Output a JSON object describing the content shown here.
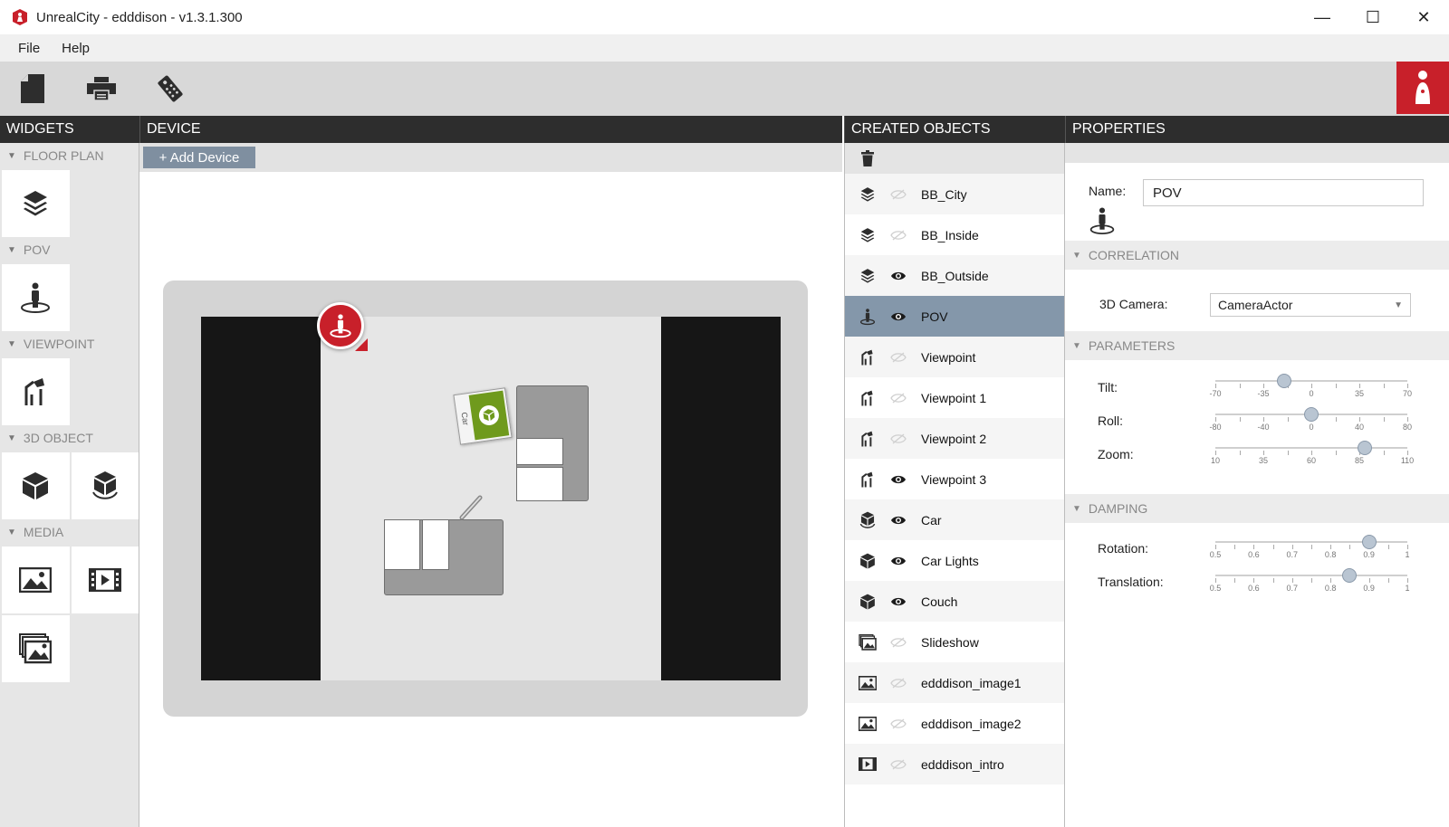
{
  "window": {
    "title": "UnrealCity  -  edddison  -  v1.3.1.300",
    "minimize": "—",
    "maximize": "☐",
    "close": "✕"
  },
  "menu": [
    "File",
    "Help"
  ],
  "toolbar": {
    "icons": [
      "new-file-icon",
      "print-icon",
      "remote-control-icon"
    ],
    "brand_color": "#c8202a"
  },
  "panels": {
    "widgets": "WIDGETS",
    "device": "DEVICE",
    "objects": "CREATED OBJECTS",
    "properties": "PROPERTIES"
  },
  "widgets": {
    "sections": [
      "FLOOR PLAN",
      "POV",
      "VIEWPOINT",
      "3D OBJECT",
      "MEDIA"
    ]
  },
  "device": {
    "add_button": "+ Add Device",
    "car_label": "Car"
  },
  "objects": {
    "items": [
      {
        "label": "BB_City",
        "icon": "layers-icon",
        "visible": false
      },
      {
        "label": "BB_Inside",
        "icon": "layers-icon",
        "visible": false
      },
      {
        "label": "BB_Outside",
        "icon": "layers-icon",
        "visible": true
      },
      {
        "label": "POV",
        "icon": "pov-icon",
        "visible": true,
        "selected": true
      },
      {
        "label": "Viewpoint",
        "icon": "viewpoint-icon",
        "visible": false
      },
      {
        "label": "Viewpoint 1",
        "icon": "viewpoint-icon",
        "visible": false
      },
      {
        "label": "Viewpoint 2",
        "icon": "viewpoint-icon",
        "visible": false
      },
      {
        "label": "Viewpoint 3",
        "icon": "viewpoint-icon",
        "visible": true
      },
      {
        "label": "Car",
        "icon": "animated-cube-icon",
        "visible": true
      },
      {
        "label": "Car Lights",
        "icon": "cube-icon",
        "visible": true
      },
      {
        "label": "Couch",
        "icon": "cube-icon",
        "visible": true
      },
      {
        "label": "Slideshow",
        "icon": "slideshow-icon",
        "visible": false
      },
      {
        "label": "edddison_image1",
        "icon": "image-icon",
        "visible": false
      },
      {
        "label": "edddison_image2",
        "icon": "image-icon",
        "visible": false
      },
      {
        "label": "edddison_intro",
        "icon": "video-icon",
        "visible": false
      }
    ]
  },
  "properties": {
    "name_label": "Name:",
    "name_value": "POV",
    "correlation": "CORRELATION",
    "camera_label": "3D Camera:",
    "camera_value": "CameraActor",
    "parameters": "PARAMETERS",
    "damping": "DAMPING",
    "sliders": {
      "tilt": {
        "label": "Tilt:",
        "ticks": [
          "-70",
          "-35",
          "0",
          "35",
          "70"
        ],
        "value": -20
      },
      "roll": {
        "label": "Roll:",
        "ticks": [
          "-80",
          "-40",
          "0",
          "40",
          "80"
        ],
        "value": 0
      },
      "zoom": {
        "label": "Zoom:",
        "ticks": [
          "10",
          "35",
          "60",
          "85",
          "110"
        ],
        "value": 88
      },
      "rotation": {
        "label": "Rotation:",
        "ticks": [
          "0.5",
          "0.6",
          "0.7",
          "0.8",
          "0.9",
          "1"
        ],
        "value": 0.9
      },
      "translation": {
        "label": "Translation:",
        "ticks": [
          "0.5",
          "0.6",
          "0.7",
          "0.8",
          "0.9",
          "1"
        ],
        "value": 0.85
      }
    }
  }
}
